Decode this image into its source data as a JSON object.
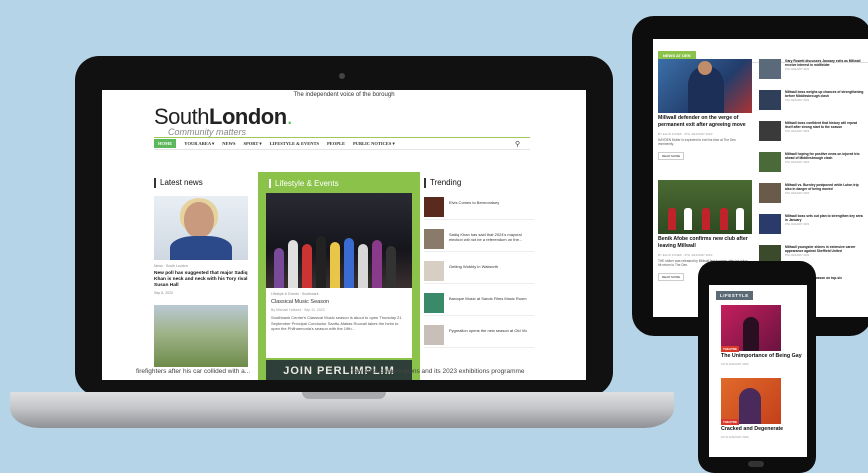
{
  "laptop": {
    "top_strip": "The independent voice of the borough",
    "logo_part1": "South",
    "logo_part2": "London",
    "logo_dot": ".",
    "logo_tagline": "Community matters",
    "nav": [
      "HOME",
      "YOUR AREA ▾",
      "NEWS",
      "SPORT ▾",
      "LIFESTYLE & EVENTS",
      "PEOPLE",
      "PUBLIC NOTICES ▾"
    ],
    "latest": {
      "title": "Latest news",
      "tags": "News · South London",
      "headline": "New poll has suggested that major Sadiq Khan is neck and neck with his Tory rival Susan Hall",
      "date": "Sep 8, 2023"
    },
    "lifestyle": {
      "title": "Lifestyle & Events",
      "tags": "Lifestyle & Events · Southwark",
      "headline": "Classical Music Season",
      "meta": "By Michael Holland · Sep 11, 2023",
      "body": "Southbank Centre's Classical Music season is about to open Thursday 21 September Principal Conductor Santtu-Matias Rouvali takes the helm to open the Philharmonia's season with the 19th...",
      "banner": "JOIN PERLIMPLIM"
    },
    "trending": {
      "title": "Trending",
      "items": [
        "Elvis Comes to Bermondsey",
        "Sadiq Khan has said that 2024's mayoral election will not be a referendum on the...",
        "Getting Wobbly in Walworth",
        "Baroque Music at Sands Films Music Room",
        "Pygmalion opens the new season at Old Vic"
      ]
    },
    "bottom_left": "firefighters after his car collided with a...",
    "bottom_right": "new artist collaborations and its 2023 exhibitions programme"
  },
  "tablet": {
    "heading": "NEWS AT DEN",
    "story1": {
      "headline": "Millwall defender on the verge of permanent exit after agreeing move",
      "meta": "BY ELLIS JONES · 9TH JANUARY 2023",
      "body": "HAYDEN Muller is expected to end his time at The Den imminently.",
      "read": "READ MORE"
    },
    "story2": {
      "headline": "Benik Afobe confirms new club after leaving Millwall",
      "meta": "BY ELLIS JONES · 9TH JANUARY 2023",
      "body": "THE striker was released by Millwall last summer after his injury-hit return to The Den.",
      "read": "READ MORE"
    },
    "list": [
      {
        "title": "Gary Rowett discusses January exits as Millwall receive interest in midfielder",
        "date": "9TH JANUARY 2023"
      },
      {
        "title": "Millwall boss weighs up chances of strengthening before Middlesbrough clash",
        "date": "9TH JANUARY 2023"
      },
      {
        "title": "Millwall boss confident that history will repeat itself after strong start to the season",
        "date": "9TH JANUARY 2023"
      },
      {
        "title": "Millwall hoping for positive news on injured trio ahead of Middlesbrough clash",
        "date": "9TH JANUARY 2023"
      },
      {
        "title": "Millwall vs. Burnley postponed while Luton trip also in danger of being moved",
        "date": "9TH JANUARY 2023"
      },
      {
        "title": "Millwall boss sets out plan to strengthen key area in January",
        "date": "9TH JANUARY 2023"
      },
      {
        "title": "Millwall youngster shines in extensive career appearance against Sheffield United",
        "date": "9TH JANUARY 2023"
      },
      {
        "title": "Times Millwall the season on top-six",
        "date": "9TH JANUARY 2023"
      }
    ]
  },
  "phone": {
    "heading": "LIFESTYLE",
    "badge": "THEATRE",
    "item1": {
      "title": "The Unimportance of Being Gay",
      "date": "12TH JANUARY 2023"
    },
    "item2": {
      "title": "Cracked and Degenerate",
      "date": "10TH JANUARY 2023"
    }
  },
  "colors": {
    "accent": "#8bc34a",
    "nav_active": "#5cb85c",
    "background": "#b6d4e8"
  }
}
